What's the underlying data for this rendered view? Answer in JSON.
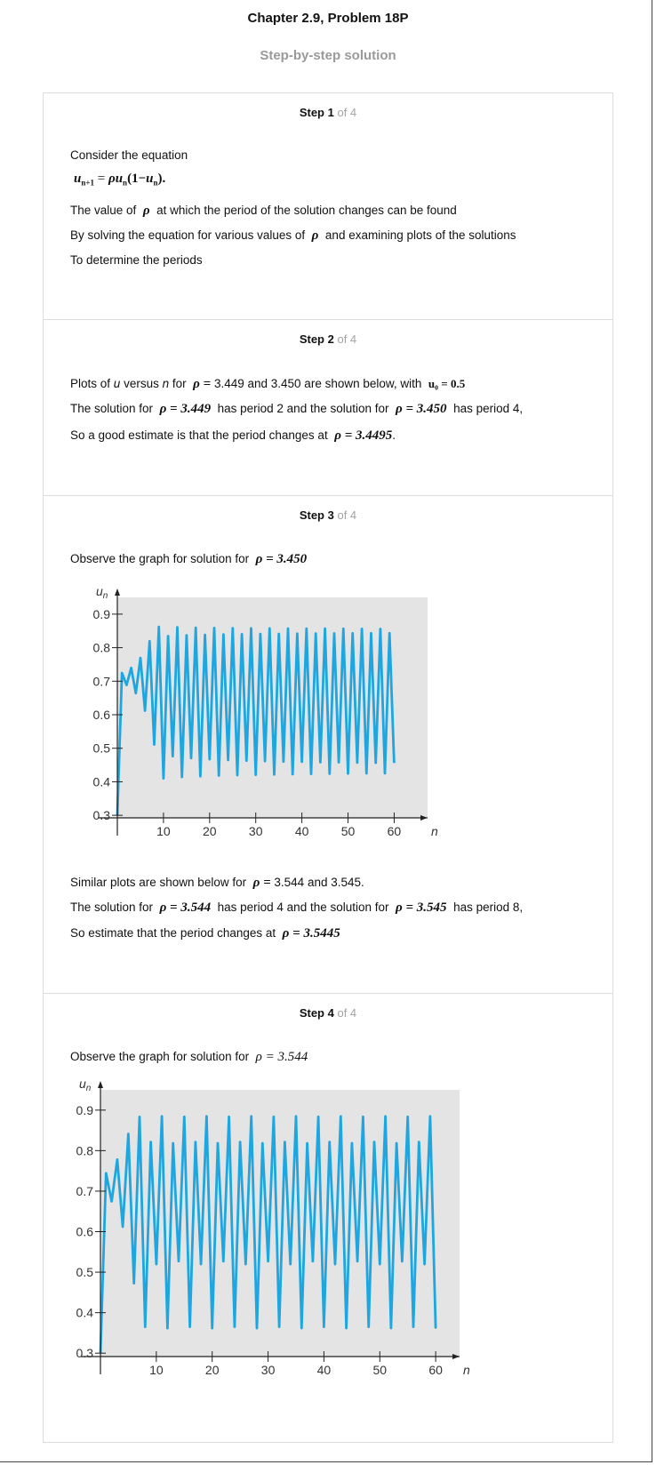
{
  "header": {
    "title": "Chapter 2.9, Problem 18P",
    "subtitle": "Step-by-step solution"
  },
  "steps": [
    {
      "label": "Step 1",
      "of": "of 4",
      "lines": [
        "Consider the equation",
        "The value of",
        "at which the period of the solution changes can be found",
        "By solving the equation for various values of",
        "and examining plots of the solutions",
        "To determine the periods"
      ],
      "equation": "u_{n+1} = ρu_n(1−u_n)."
    },
    {
      "label": "Step 2",
      "of": "of 4",
      "line1_a": "Plots of",
      "line1_u": "u",
      "line1_b": "versus",
      "line1_n": "n",
      "line1_c": "for",
      "line1_d": "3.449 and 3.450 are shown below, with",
      "line1_eq": "u₀ = 0.5",
      "line2_a": "The solution for",
      "line2_eq1": "ρ = 3.449",
      "line2_b": "has period 2 and the solution for",
      "line2_eq2": "ρ = 3.450",
      "line2_c": "has period 4,",
      "line3_a": "So a good estimate is that the period changes at",
      "line3_eq": "ρ = 3.4495",
      "line3_b": "."
    },
    {
      "label": "Step 3",
      "of": "of 4",
      "line1_a": "Observe the graph for solution for",
      "line1_eq": "ρ = 3.450",
      "line2_a": "Similar plots are shown below for",
      "line2_b": "3.544 and 3.545.",
      "line3_a": "The solution for",
      "line3_eq1": "ρ = 3.544",
      "line3_b": "has period 4 and the solution for",
      "line3_eq2": "ρ = 3.545",
      "line3_c": "has period 8,",
      "line4_a": "So estimate that the period changes at",
      "line4_eq": "ρ = 3.5445"
    },
    {
      "label": "Step 4",
      "of": "of 4",
      "line1_a": "Observe the graph for solution for",
      "line1_eq": "ρ = 3.544"
    }
  ],
  "symbols": {
    "rho": "ρ",
    "rho_eq": "ρ ="
  },
  "chart_data": [
    {
      "type": "line",
      "title": "",
      "xlabel": "n",
      "ylabel": "u_n",
      "xlim": [
        0,
        63
      ],
      "ylim": [
        0.25,
        0.95
      ],
      "xticks": [
        10,
        20,
        30,
        40,
        50,
        60
      ],
      "yticks": [
        0.3,
        0.4,
        0.5,
        0.6,
        0.7,
        0.8,
        0.9
      ],
      "x_tick_labels": [
        "10",
        "20",
        "30",
        "40",
        "50",
        "60"
      ],
      "y_tick_labels": [
        "0.3",
        "0.4",
        "0.5",
        "0.6",
        "0.7",
        "0.8",
        "0.9"
      ],
      "background": "#e4e4e4",
      "series": [
        {
          "color": "#1ea6e0",
          "rho": 3.45,
          "u0": 0.3,
          "n": 60
        }
      ]
    },
    {
      "type": "line",
      "title": "",
      "xlabel": "n",
      "ylabel": "u_n",
      "xlim": [
        0,
        63
      ],
      "ylim": [
        0.25,
        0.95
      ],
      "xticks": [
        10,
        20,
        30,
        40,
        50,
        60
      ],
      "yticks": [
        0.3,
        0.4,
        0.5,
        0.6,
        0.7,
        0.8,
        0.9
      ],
      "x_tick_labels": [
        "10",
        "20",
        "30",
        "40",
        "50",
        "60"
      ],
      "y_tick_labels": [
        "0.3",
        "0.4",
        "0.5",
        "0.6",
        "0.7",
        "0.8",
        "0.9"
      ],
      "background": "#e4e4e4",
      "series": [
        {
          "color": "#555555",
          "rho": 3.545,
          "u0": 0.3,
          "n": 60
        },
        {
          "color": "#1ea6e0",
          "rho": 3.544,
          "u0": 0.3,
          "n": 60
        }
      ]
    }
  ]
}
